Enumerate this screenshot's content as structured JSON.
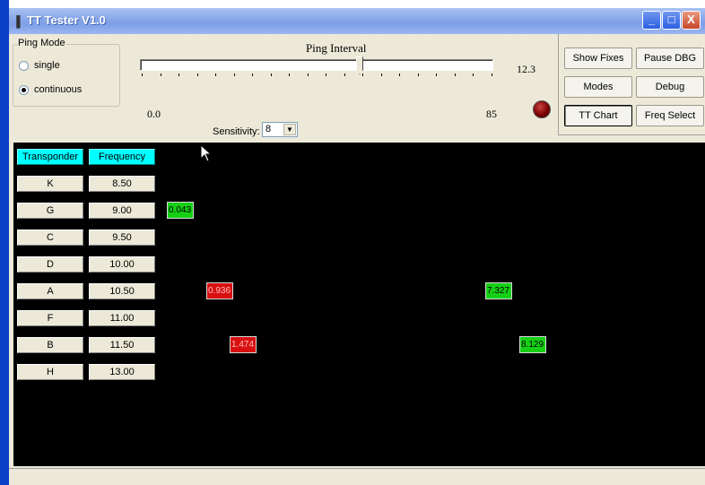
{
  "window": {
    "title": "TT Tester V1.0",
    "controls": [
      "_",
      "□",
      "X"
    ]
  },
  "ping_mode": {
    "legend": "Ping Mode",
    "options": [
      {
        "label": "single",
        "selected": false
      },
      {
        "label": "continuous",
        "selected": true
      }
    ]
  },
  "ping_interval": {
    "label": "Ping Interval",
    "value_text": "12.3",
    "min_label": "0.0",
    "max_label": "85",
    "value": 12.3
  },
  "sensitivity": {
    "label": "Sensitivity:",
    "value": "8"
  },
  "indicator": {
    "color": "#7a0000",
    "icon": "status-led"
  },
  "buttons": {
    "show_fixes": "Show Fixes",
    "pause_dbg": "Pause DBG",
    "modes": "Modes",
    "debug": "Debug",
    "tt_chart": "TT Chart",
    "freq_select": "Freq Select"
  },
  "table": {
    "headers": [
      "Transponder",
      "Frequency"
    ],
    "rows": [
      {
        "transponder": "K",
        "frequency": "8.50"
      },
      {
        "transponder": "G",
        "frequency": "9.00"
      },
      {
        "transponder": "C",
        "frequency": "9.50"
      },
      {
        "transponder": "D",
        "frequency": "10.00"
      },
      {
        "transponder": "A",
        "frequency": "10.50"
      },
      {
        "transponder": "F",
        "frequency": "11.00"
      },
      {
        "transponder": "B",
        "frequency": "11.50"
      },
      {
        "transponder": "H",
        "frequency": "13.00"
      }
    ]
  },
  "markers": [
    {
      "row": "G",
      "value": "0.043",
      "color": "green"
    },
    {
      "row": "A",
      "value": "0.936",
      "color": "red"
    },
    {
      "row": "A",
      "value": "7.327",
      "color": "green"
    },
    {
      "row": "B",
      "value": "1.474",
      "color": "red"
    },
    {
      "row": "B",
      "value": "8.129",
      "color": "green"
    }
  ],
  "colors": {
    "header_cell": "#00ffff",
    "marker_green": "#16d016",
    "marker_red": "#d81010",
    "display_bg": "#000000"
  }
}
